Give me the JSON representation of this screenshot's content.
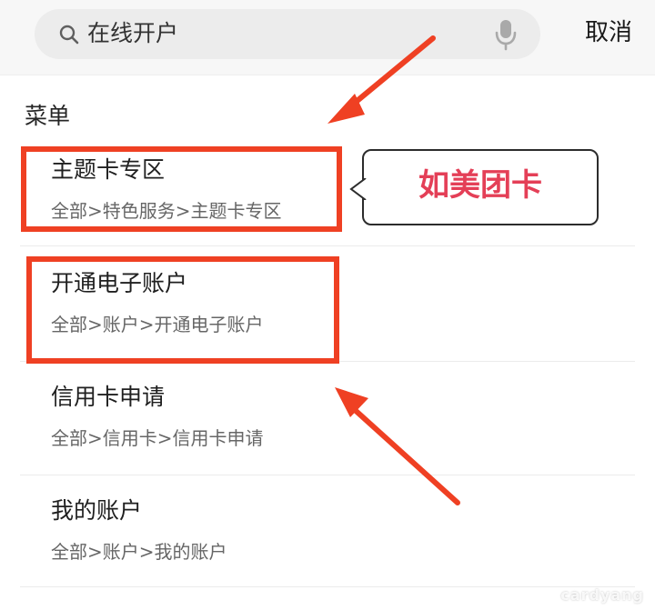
{
  "search": {
    "query": "在线开户",
    "cancel_label": "取消"
  },
  "section": {
    "title": "菜单"
  },
  "menu_items": [
    {
      "title": "主题卡专区",
      "path": "全部>特色服务>主题卡专区"
    },
    {
      "title": "开通电子账户",
      "path": "全部>账户>开通电子账户"
    },
    {
      "title": "信用卡申请",
      "path": "全部>信用卡>信用卡申请"
    },
    {
      "title": "我的账户",
      "path": "全部>账户>我的账户"
    }
  ],
  "annotation": {
    "callout_text": "如美团卡"
  },
  "watermark": {
    "text": "cardyang"
  },
  "colors": {
    "highlight": "#ef4023",
    "callout_text": "#e43f57",
    "arrow": "#ef4023"
  },
  "icons": {
    "search": "search-icon",
    "microphone": "microphone-icon",
    "arrow": "arrow-icon"
  }
}
